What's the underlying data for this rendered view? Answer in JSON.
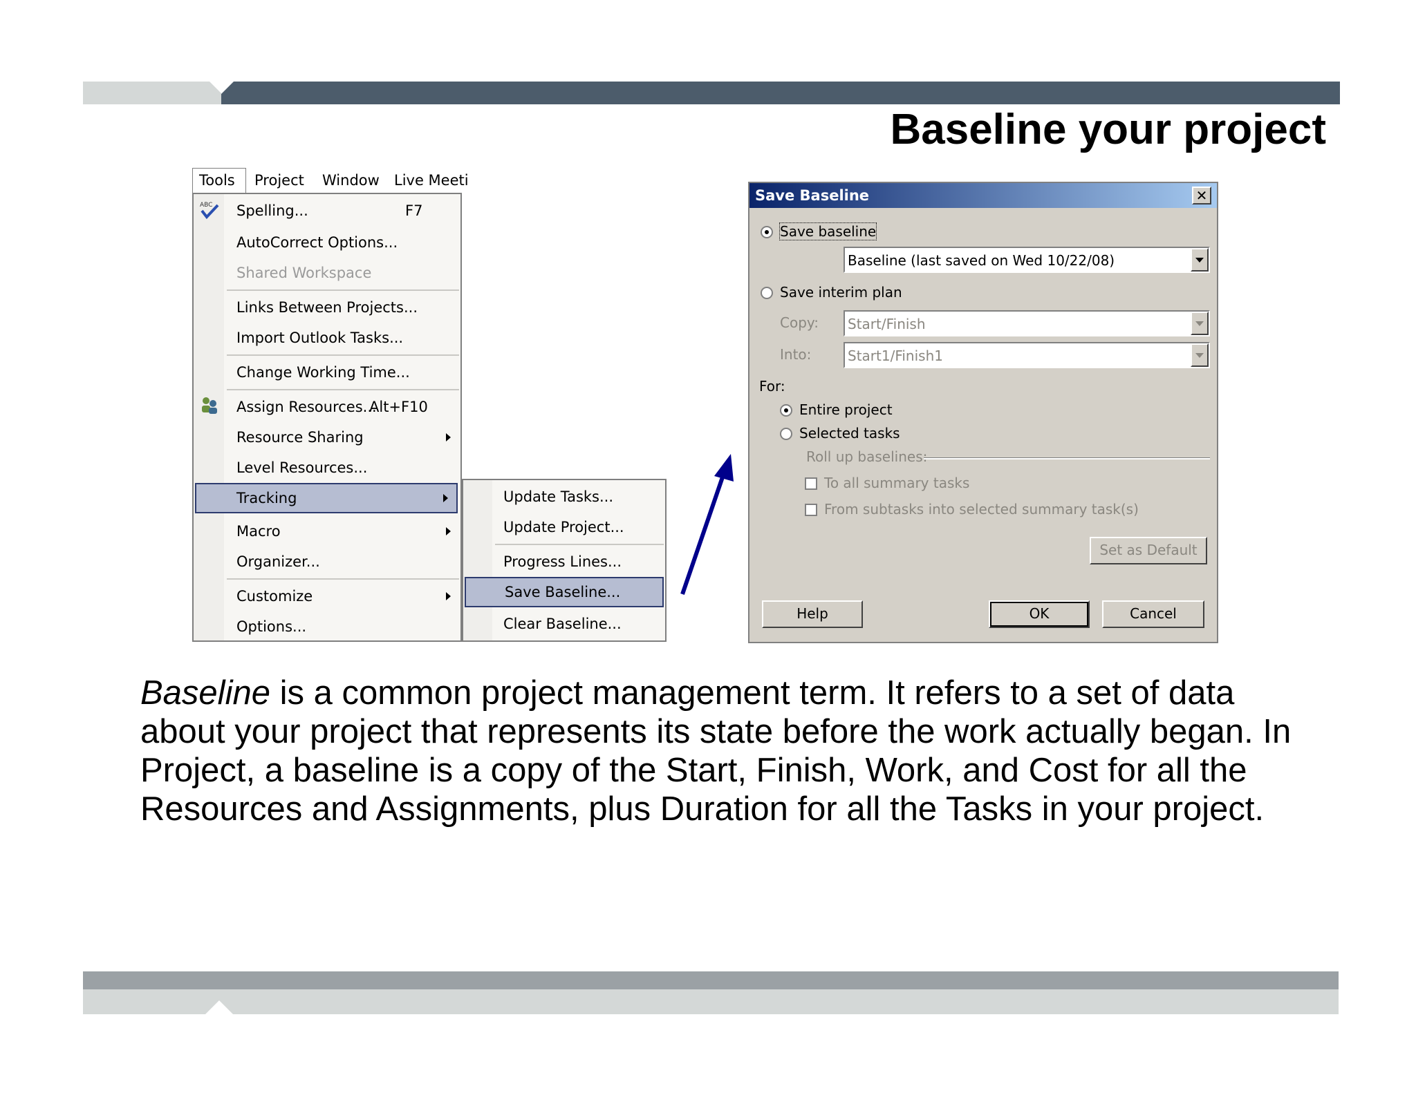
{
  "slide": {
    "title": "Baseline your project",
    "paragraph_term": "Baseline",
    "paragraph_rest": " is a common project management term. It refers to a set of data about your project that represents its state before the work actually began. In Project, a baseline is a copy of the Start, Finish, Work, and Cost for all the Resources and Assignments, plus Duration for all the Tasks in your project."
  },
  "menubar": {
    "items": [
      "Tools",
      "Project",
      "Window",
      "Live Meeti"
    ]
  },
  "tools_menu": {
    "items": [
      {
        "label": "Spelling...",
        "shortcut": "F7"
      },
      {
        "label": "AutoCorrect Options..."
      },
      {
        "label": "Shared Workspace",
        "disabled": true
      },
      {
        "label": "Links Between Projects..."
      },
      {
        "label": "Import Outlook Tasks..."
      },
      {
        "label": "Change Working Time..."
      },
      {
        "label": "Assign Resources...",
        "shortcut": "Alt+F10"
      },
      {
        "label": "Resource Sharing"
      },
      {
        "label": "Level Resources..."
      },
      {
        "label": "Tracking"
      },
      {
        "label": "Macro"
      },
      {
        "label": "Organizer..."
      },
      {
        "label": "Customize"
      },
      {
        "label": "Options..."
      }
    ]
  },
  "tracking_submenu": {
    "items": [
      "Update Tasks...",
      "Update Project...",
      "Progress Lines...",
      "Save Baseline...",
      "Clear Baseline..."
    ]
  },
  "dialog": {
    "title": "Save Baseline",
    "close": "✕",
    "save_baseline_label": "Save baseline",
    "baseline_value": "Baseline (last saved on Wed 10/22/08)",
    "save_interim_label": "Save interim plan",
    "copy_label": "Copy:",
    "copy_value": "Start/Finish",
    "into_label": "Into:",
    "into_value": "Start1/Finish1",
    "for_label": "For:",
    "entire_project_label": "Entire project",
    "selected_tasks_label": "Selected tasks",
    "rollup_label": "Roll up baselines:",
    "to_all_summary_label": "To all summary tasks",
    "from_subtasks_label": "From subtasks into selected summary task(s)",
    "set_default_label": "Set as Default",
    "help_label": "Help",
    "ok_label": "OK",
    "cancel_label": "Cancel"
  },
  "colors": {
    "title_bar_dark": "#4c5c6b",
    "highlight": "#b6bdd2",
    "dialog_face": "#d4d0c8",
    "arrow": "#00008b"
  }
}
